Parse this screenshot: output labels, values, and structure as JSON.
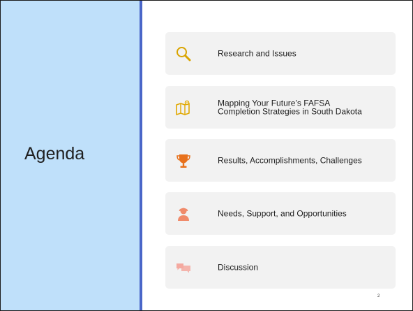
{
  "slide": {
    "title": "Agenda",
    "page_number": "2"
  },
  "agenda_items": [
    {
      "label": "Research and Issues",
      "icon": "magnifying-glass-icon",
      "color": "#d9a400"
    },
    {
      "label": "Mapping Your Future’s FAFSA\nCompletion Strategies in South Dakota",
      "icon": "map-icon",
      "color": "#e0a800"
    },
    {
      "label": "Results, Accomplishments, Challenges",
      "icon": "trophy-icon",
      "color": "#e8711c"
    },
    {
      "label": "Needs, Support, and Opportunities",
      "icon": "person-with-headset-icon",
      "color": "#f08a6a"
    },
    {
      "label": "Discussion",
      "icon": "speech-bubbles-icon",
      "color": "#f4a9a0"
    }
  ],
  "colors": {
    "left_panel": "#bfe0fa",
    "divider": "#4a66c8",
    "item_background": "#f2f2f2"
  }
}
